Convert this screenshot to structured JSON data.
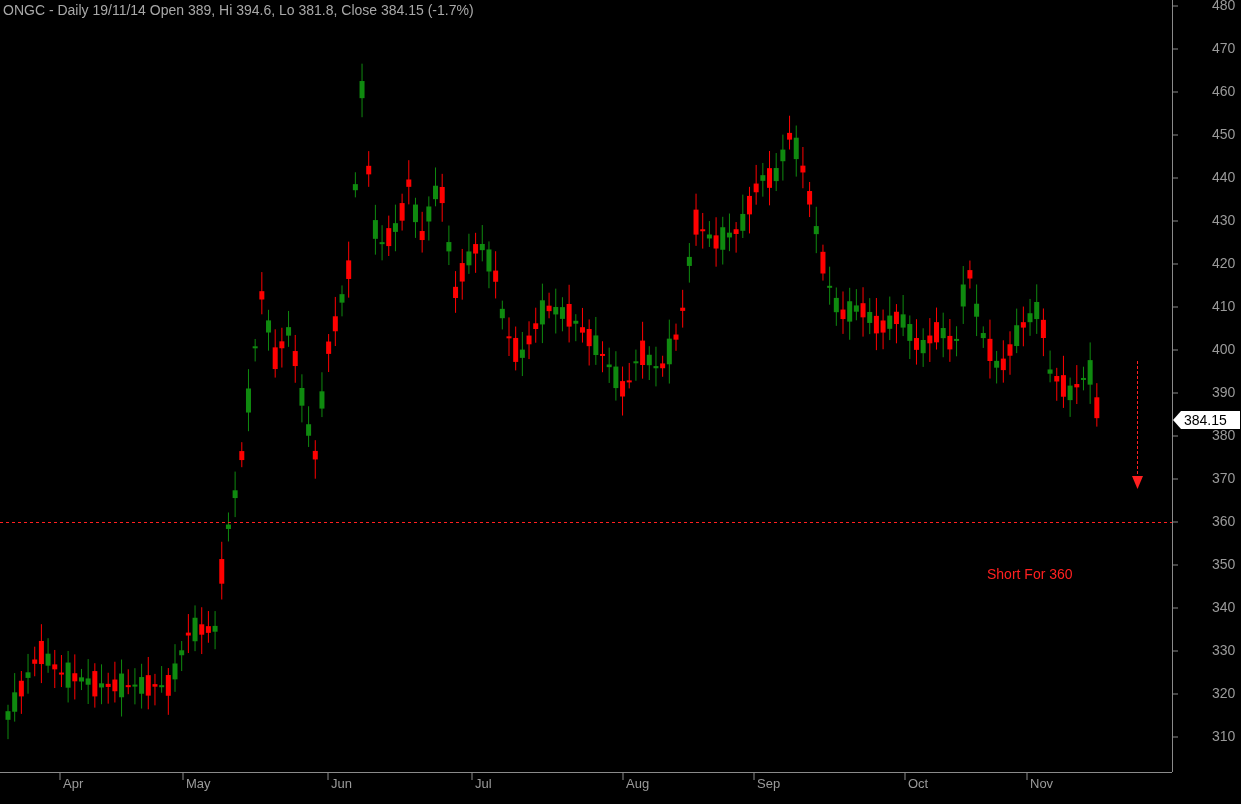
{
  "chart": {
    "title": "ONGC - Daily 19/11/14 Open 389, Hi 394.6, Lo 381.8, Close 384.15 (-1.7%)",
    "y_axis_labels": [
      "480",
      "470",
      "460",
      "450",
      "440",
      "430",
      "420",
      "410",
      "400",
      "390",
      "380",
      "370",
      "360",
      "350",
      "340",
      "330",
      "320",
      "310"
    ],
    "x_axis_labels": [
      "Apr",
      "May",
      "Jun",
      "Jul",
      "Aug",
      "Sep",
      "Oct",
      "Nov"
    ],
    "last_price_tag": "384.15",
    "annotation": "Short For 360"
  }
}
